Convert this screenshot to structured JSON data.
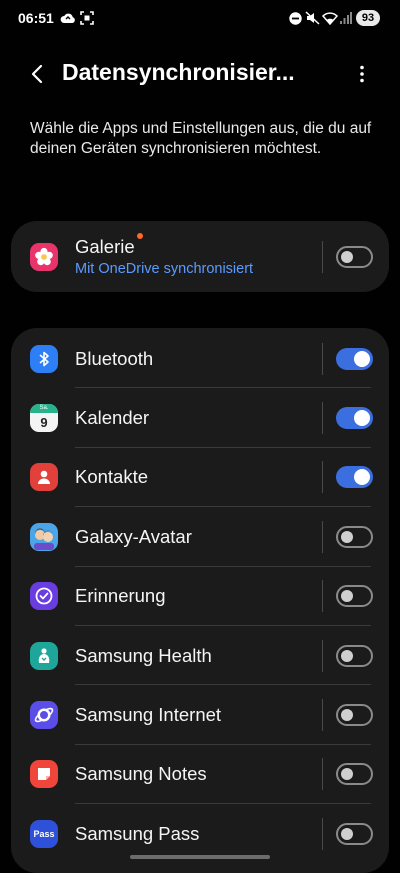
{
  "status_bar": {
    "time": "06:51",
    "battery": "93",
    "icons": [
      "cloud-sync-icon",
      "screenshot-icon",
      "do-not-disturb-icon",
      "mute-icon",
      "wifi-icon",
      "signal-icon"
    ]
  },
  "app_bar": {
    "title": "Datensynchronisier...",
    "back_icon": "back-arrow-icon",
    "more_icon": "more-vert-icon"
  },
  "description": "Wähle die Apps und Einstellungen aus, die du auf deinen Geräten synchronisieren möchtest.",
  "galerie": {
    "label": "Galerie",
    "subtitle": "Mit OneDrive synchronisiert",
    "icon": "gallery-icon",
    "enabled": false,
    "has_new_badge": true
  },
  "apps": [
    {
      "label": "Bluetooth",
      "icon": "bluetooth-icon",
      "enabled": true
    },
    {
      "label": "Kalender",
      "icon": "calendar-icon",
      "enabled": true,
      "icon_text_top": "Sa.",
      "icon_text_day": "9"
    },
    {
      "label": "Kontakte",
      "icon": "contacts-icon",
      "enabled": true
    },
    {
      "label": "Galaxy-Avatar",
      "icon": "avatar-icon",
      "enabled": false
    },
    {
      "label": "Erinnerung",
      "icon": "reminder-icon",
      "enabled": false
    },
    {
      "label": "Samsung Health",
      "icon": "health-icon",
      "enabled": false
    },
    {
      "label": "Samsung Internet",
      "icon": "internet-icon",
      "enabled": false
    },
    {
      "label": "Samsung Notes",
      "icon": "notes-icon",
      "enabled": false
    },
    {
      "label": "Samsung Pass",
      "icon": "pass-icon",
      "enabled": false,
      "icon_text": "Pass"
    }
  ],
  "colors": {
    "background": "#010101",
    "card": "#1b1b1b",
    "accent": "#3b6fe0",
    "link": "#5b9bff",
    "badge_dot": "#ff6a2a"
  }
}
